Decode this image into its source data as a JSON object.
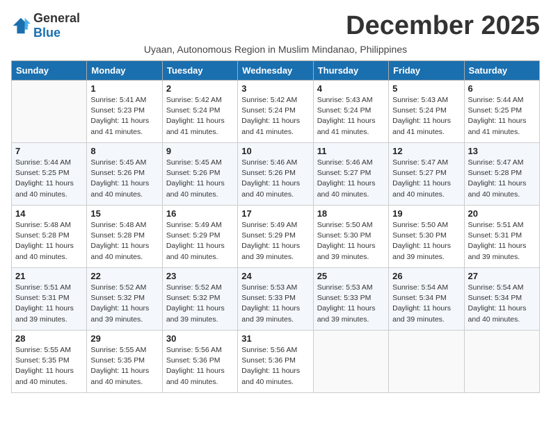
{
  "logo": {
    "general": "General",
    "blue": "Blue"
  },
  "title": "December 2025",
  "subtitle": "Uyaan, Autonomous Region in Muslim Mindanao, Philippines",
  "days_header": [
    "Sunday",
    "Monday",
    "Tuesday",
    "Wednesday",
    "Thursday",
    "Friday",
    "Saturday"
  ],
  "weeks": [
    [
      {
        "num": "",
        "sunrise": "",
        "sunset": "",
        "daylight": ""
      },
      {
        "num": "1",
        "sunrise": "Sunrise: 5:41 AM",
        "sunset": "Sunset: 5:23 PM",
        "daylight": "Daylight: 11 hours and 41 minutes."
      },
      {
        "num": "2",
        "sunrise": "Sunrise: 5:42 AM",
        "sunset": "Sunset: 5:24 PM",
        "daylight": "Daylight: 11 hours and 41 minutes."
      },
      {
        "num": "3",
        "sunrise": "Sunrise: 5:42 AM",
        "sunset": "Sunset: 5:24 PM",
        "daylight": "Daylight: 11 hours and 41 minutes."
      },
      {
        "num": "4",
        "sunrise": "Sunrise: 5:43 AM",
        "sunset": "Sunset: 5:24 PM",
        "daylight": "Daylight: 11 hours and 41 minutes."
      },
      {
        "num": "5",
        "sunrise": "Sunrise: 5:43 AM",
        "sunset": "Sunset: 5:24 PM",
        "daylight": "Daylight: 11 hours and 41 minutes."
      },
      {
        "num": "6",
        "sunrise": "Sunrise: 5:44 AM",
        "sunset": "Sunset: 5:25 PM",
        "daylight": "Daylight: 11 hours and 41 minutes."
      }
    ],
    [
      {
        "num": "7",
        "sunrise": "Sunrise: 5:44 AM",
        "sunset": "Sunset: 5:25 PM",
        "daylight": "Daylight: 11 hours and 40 minutes."
      },
      {
        "num": "8",
        "sunrise": "Sunrise: 5:45 AM",
        "sunset": "Sunset: 5:26 PM",
        "daylight": "Daylight: 11 hours and 40 minutes."
      },
      {
        "num": "9",
        "sunrise": "Sunrise: 5:45 AM",
        "sunset": "Sunset: 5:26 PM",
        "daylight": "Daylight: 11 hours and 40 minutes."
      },
      {
        "num": "10",
        "sunrise": "Sunrise: 5:46 AM",
        "sunset": "Sunset: 5:26 PM",
        "daylight": "Daylight: 11 hours and 40 minutes."
      },
      {
        "num": "11",
        "sunrise": "Sunrise: 5:46 AM",
        "sunset": "Sunset: 5:27 PM",
        "daylight": "Daylight: 11 hours and 40 minutes."
      },
      {
        "num": "12",
        "sunrise": "Sunrise: 5:47 AM",
        "sunset": "Sunset: 5:27 PM",
        "daylight": "Daylight: 11 hours and 40 minutes."
      },
      {
        "num": "13",
        "sunrise": "Sunrise: 5:47 AM",
        "sunset": "Sunset: 5:28 PM",
        "daylight": "Daylight: 11 hours and 40 minutes."
      }
    ],
    [
      {
        "num": "14",
        "sunrise": "Sunrise: 5:48 AM",
        "sunset": "Sunset: 5:28 PM",
        "daylight": "Daylight: 11 hours and 40 minutes."
      },
      {
        "num": "15",
        "sunrise": "Sunrise: 5:48 AM",
        "sunset": "Sunset: 5:28 PM",
        "daylight": "Daylight: 11 hours and 40 minutes."
      },
      {
        "num": "16",
        "sunrise": "Sunrise: 5:49 AM",
        "sunset": "Sunset: 5:29 PM",
        "daylight": "Daylight: 11 hours and 40 minutes."
      },
      {
        "num": "17",
        "sunrise": "Sunrise: 5:49 AM",
        "sunset": "Sunset: 5:29 PM",
        "daylight": "Daylight: 11 hours and 39 minutes."
      },
      {
        "num": "18",
        "sunrise": "Sunrise: 5:50 AM",
        "sunset": "Sunset: 5:30 PM",
        "daylight": "Daylight: 11 hours and 39 minutes."
      },
      {
        "num": "19",
        "sunrise": "Sunrise: 5:50 AM",
        "sunset": "Sunset: 5:30 PM",
        "daylight": "Daylight: 11 hours and 39 minutes."
      },
      {
        "num": "20",
        "sunrise": "Sunrise: 5:51 AM",
        "sunset": "Sunset: 5:31 PM",
        "daylight": "Daylight: 11 hours and 39 minutes."
      }
    ],
    [
      {
        "num": "21",
        "sunrise": "Sunrise: 5:51 AM",
        "sunset": "Sunset: 5:31 PM",
        "daylight": "Daylight: 11 hours and 39 minutes."
      },
      {
        "num": "22",
        "sunrise": "Sunrise: 5:52 AM",
        "sunset": "Sunset: 5:32 PM",
        "daylight": "Daylight: 11 hours and 39 minutes."
      },
      {
        "num": "23",
        "sunrise": "Sunrise: 5:52 AM",
        "sunset": "Sunset: 5:32 PM",
        "daylight": "Daylight: 11 hours and 39 minutes."
      },
      {
        "num": "24",
        "sunrise": "Sunrise: 5:53 AM",
        "sunset": "Sunset: 5:33 PM",
        "daylight": "Daylight: 11 hours and 39 minutes."
      },
      {
        "num": "25",
        "sunrise": "Sunrise: 5:53 AM",
        "sunset": "Sunset: 5:33 PM",
        "daylight": "Daylight: 11 hours and 39 minutes."
      },
      {
        "num": "26",
        "sunrise": "Sunrise: 5:54 AM",
        "sunset": "Sunset: 5:34 PM",
        "daylight": "Daylight: 11 hours and 39 minutes."
      },
      {
        "num": "27",
        "sunrise": "Sunrise: 5:54 AM",
        "sunset": "Sunset: 5:34 PM",
        "daylight": "Daylight: 11 hours and 40 minutes."
      }
    ],
    [
      {
        "num": "28",
        "sunrise": "Sunrise: 5:55 AM",
        "sunset": "Sunset: 5:35 PM",
        "daylight": "Daylight: 11 hours and 40 minutes."
      },
      {
        "num": "29",
        "sunrise": "Sunrise: 5:55 AM",
        "sunset": "Sunset: 5:35 PM",
        "daylight": "Daylight: 11 hours and 40 minutes."
      },
      {
        "num": "30",
        "sunrise": "Sunrise: 5:56 AM",
        "sunset": "Sunset: 5:36 PM",
        "daylight": "Daylight: 11 hours and 40 minutes."
      },
      {
        "num": "31",
        "sunrise": "Sunrise: 5:56 AM",
        "sunset": "Sunset: 5:36 PM",
        "daylight": "Daylight: 11 hours and 40 minutes."
      },
      {
        "num": "",
        "sunrise": "",
        "sunset": "",
        "daylight": ""
      },
      {
        "num": "",
        "sunrise": "",
        "sunset": "",
        "daylight": ""
      },
      {
        "num": "",
        "sunrise": "",
        "sunset": "",
        "daylight": ""
      }
    ]
  ]
}
